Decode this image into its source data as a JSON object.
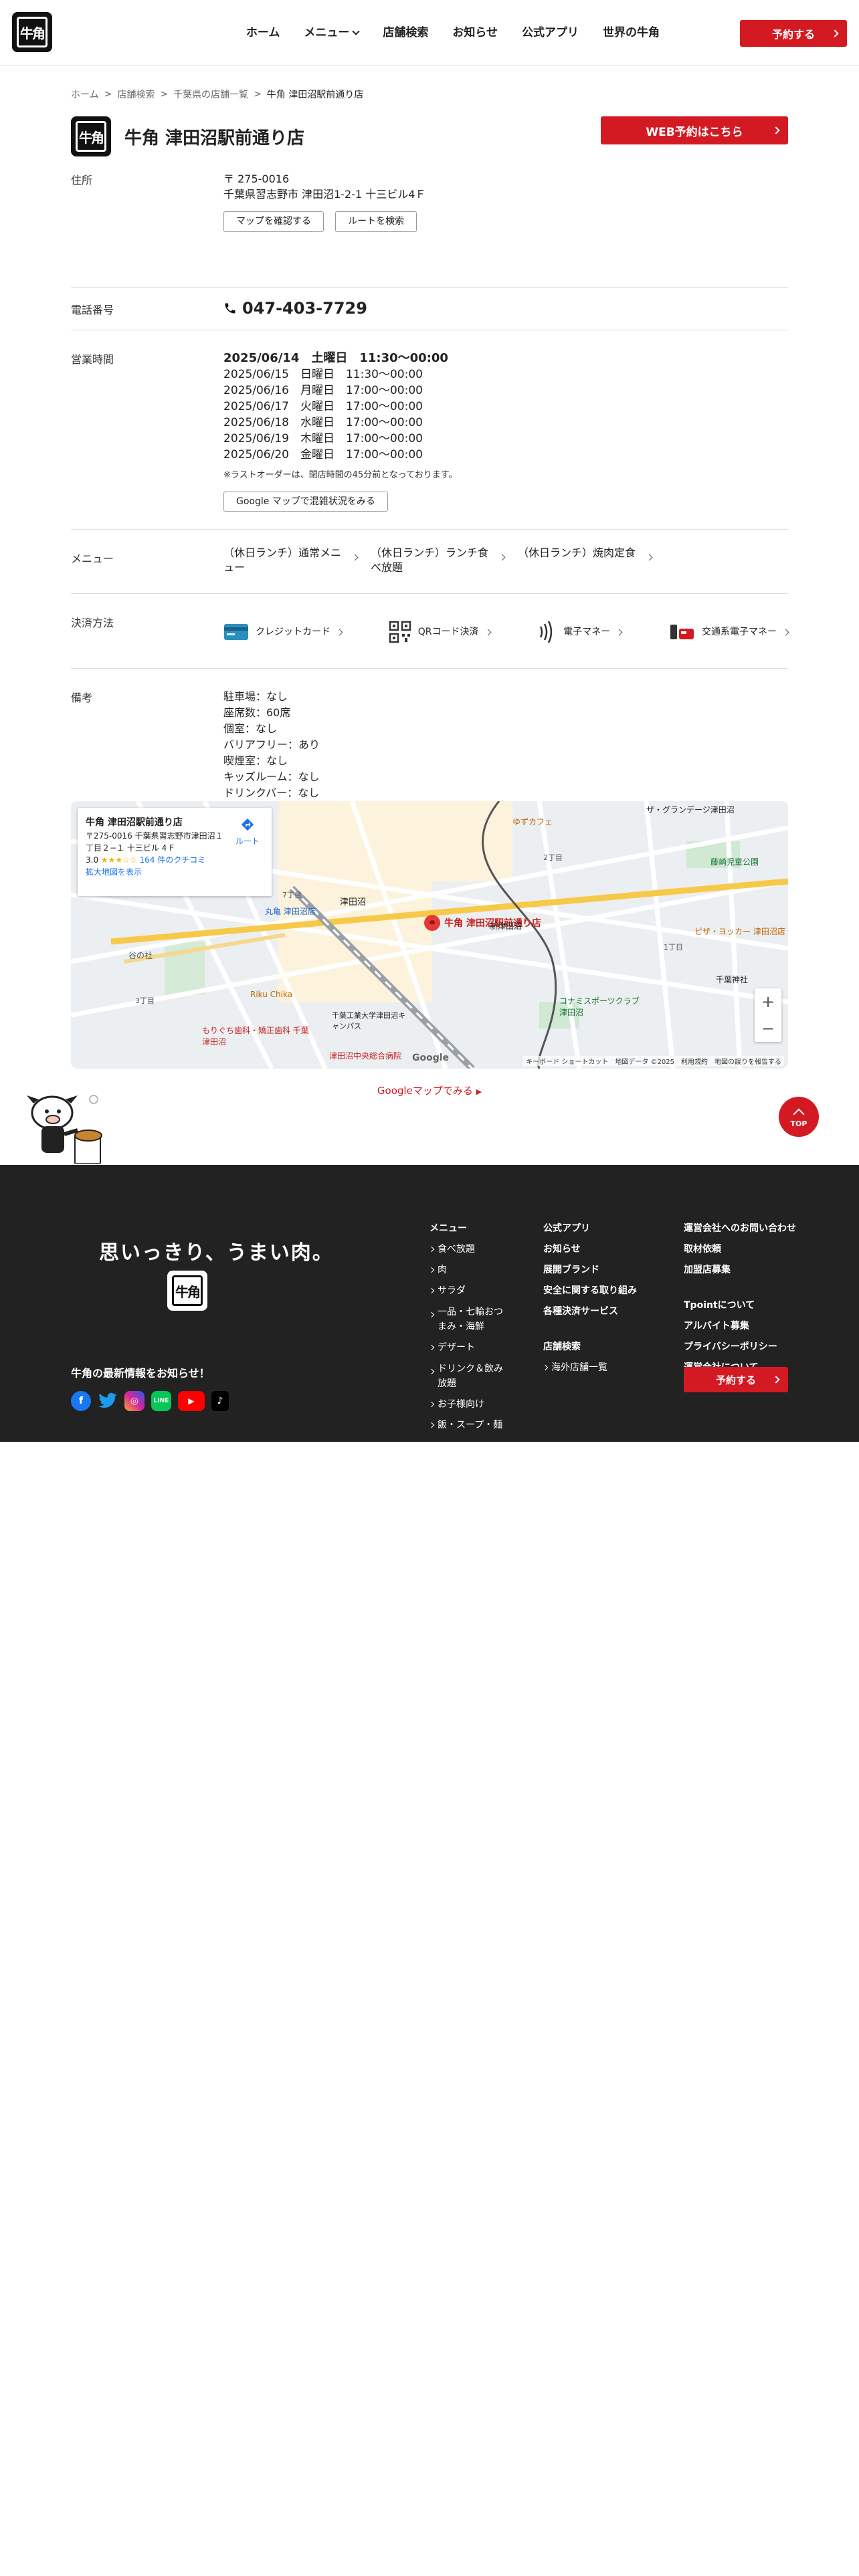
{
  "header": {
    "logo_text": "牛角",
    "nav": [
      "ホーム",
      "メニュー",
      "店舗検索",
      "お知らせ",
      "公式アプリ",
      "世界の牛角"
    ],
    "reserve_label": "予約する"
  },
  "breadcrumb": [
    "ホーム",
    "店舗検索",
    "千葉県の店舗一覧",
    "牛角 津田沼駅前通り店"
  ],
  "store": {
    "name": "牛角 津田沼駅前通り店",
    "web_reserve_label": "WEB予約はこちら"
  },
  "address": {
    "label": "住所",
    "zip": "〒 275-0016",
    "line": "千葉県習志野市 津田沼1-2-1 十三ビル4Ｆ",
    "btn_map": "マップを確認する",
    "btn_route": "ルートを検索"
  },
  "phone": {
    "label": "電話番号",
    "number": "047-403-7729"
  },
  "hours": {
    "label": "営業時間",
    "today": "2025/06/14　土曜日　11:30〜00:00",
    "lines": [
      "2025/06/15　日曜日　11:30〜00:00",
      "2025/06/16　月曜日　17:00〜00:00",
      "2025/06/17　火曜日　17:00〜00:00",
      "2025/06/18　水曜日　17:00〜00:00",
      "2025/06/19　木曜日　17:00〜00:00",
      "2025/06/20　金曜日　17:00〜00:00"
    ],
    "note": "※ラストオーダーは、閉店時間の45分前となっております。",
    "congestion_btn": "Google マップで混雑状況をみる"
  },
  "menu": {
    "label": "メニュー",
    "items": [
      "（休日ランチ）通常メニュー",
      "（休日ランチ）ランチ食べ放題",
      "（休日ランチ）焼肉定食"
    ]
  },
  "payment": {
    "label": "決済方法",
    "items": [
      "クレジットカード",
      "QRコード決済",
      "電子マネー",
      "交通系電子マネー"
    ]
  },
  "remarks": {
    "label": "備考",
    "lines": [
      "駐車場：なし",
      "座席数：60席",
      "個室：なし",
      "バリアフリー：あり",
      "喫煙室：なし",
      "キッズルーム：なし",
      "ドリンクバー：なし"
    ]
  },
  "map": {
    "card_title": "牛角 津田沼駅前通り店",
    "card_address": "〒275-0016 千葉県習志野市津田沼１丁目２−１ 十三ビル 4 F",
    "rating": "3.0",
    "stars": "★★★☆☆",
    "reviews": "164 件のクチコミ",
    "enlarge": "拡大地図を表示",
    "route": "ルート",
    "pin_label": "牛角 津田沼駅前通り店",
    "labels": [
      "津田沼",
      "新津田沼",
      "丸亀 津田沼店",
      "Riku Chika",
      "千葉工業大学津田沼キャンパス",
      "コナミスポーツクラブ 津田沼",
      "ゆずカフェ",
      "ピザ・ヨッカー 津田沼店",
      "もりぐち歯科・矯正歯科 千葉津田沼",
      "津田沼中央総合病院",
      "藤崎児童公園",
      "ザ・グランデージ津田沼",
      "千葉神社",
      "2丁目",
      "7丁目",
      "3丁目",
      "1丁目",
      "谷の社"
    ],
    "footer": "キーボード ショートカット　地図データ ©2025　利用規約　地図の誤りを報告する",
    "google": "Google",
    "link": "Googleマップでみる"
  },
  "footer": {
    "top": "TOP",
    "slogan": "思いっきり、うまい肉。",
    "logo_text": "牛角",
    "news": "牛角の最新情報をお知らせ！",
    "sns": [
      "facebook-icon",
      "twitter-icon",
      "instagram-icon",
      "line-icon",
      "youtube-icon",
      "tiktok-icon"
    ],
    "col1_title": "メニュー",
    "col1": [
      "食べ放題",
      "肉",
      "サラダ",
      "一品・七輪おつまみ・海鮮",
      "デザート",
      "ドリンク＆飲み放題",
      "お子様向け",
      "飯・スープ・麺"
    ],
    "col2": [
      "公式アプリ",
      "お知らせ",
      "展開ブランド",
      "安全に関する取り組み",
      "各種決済サービス"
    ],
    "col2b_title": "店舗検索",
    "col2b": [
      "海外店舗一覧"
    ],
    "col3": [
      "運営会社へのお問い合わせ",
      "取材依頼",
      "加盟店募集"
    ],
    "col3b": [
      "Tpointについて",
      "アルバイト募集",
      "プライバシーポリシー",
      "運営会社について"
    ],
    "reserve_label": "予約する"
  }
}
